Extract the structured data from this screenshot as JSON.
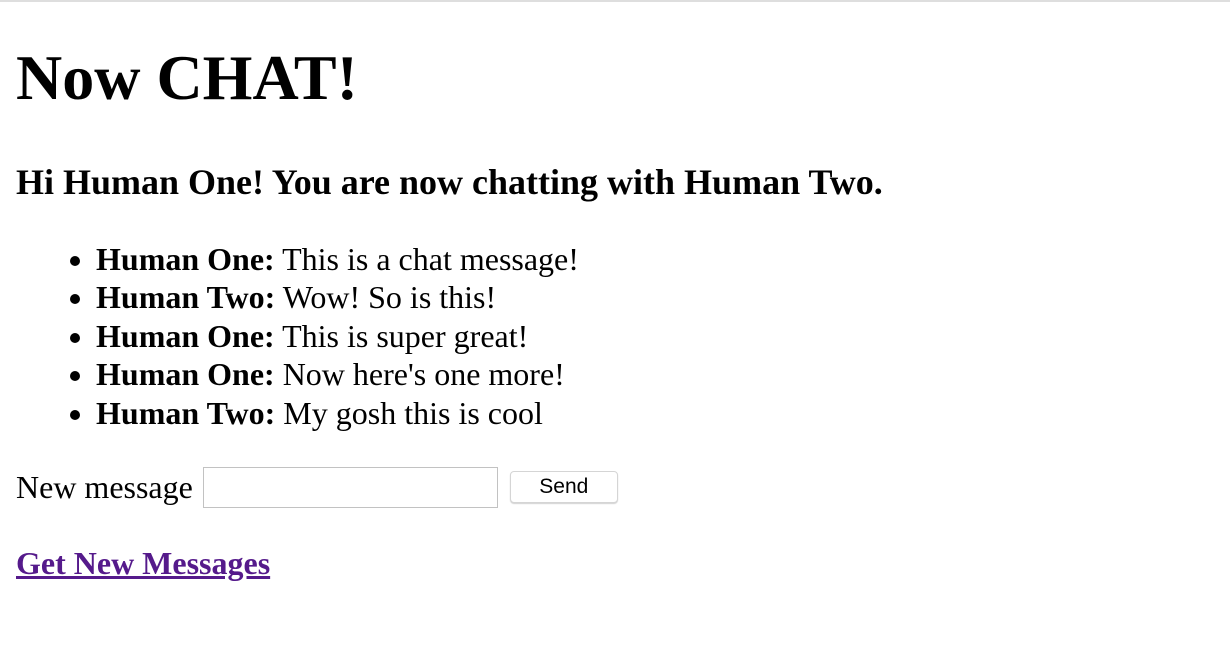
{
  "page": {
    "title": "Now CHAT!",
    "subtitle": "Hi Human One! You are now chatting with Human Two."
  },
  "messages": [
    {
      "sender": "Human One:",
      "text": "This is a chat message!"
    },
    {
      "sender": "Human Two:",
      "text": "Wow! So is this!"
    },
    {
      "sender": "Human One:",
      "text": "This is super great!"
    },
    {
      "sender": "Human One:",
      "text": "Now here's one more!"
    },
    {
      "sender": "Human Two:",
      "text": "My gosh this is cool"
    }
  ],
  "composer": {
    "label": "New message",
    "value": "",
    "send_label": "Send"
  },
  "links": {
    "get_new_messages": "Get New Messages"
  },
  "colors": {
    "visited_link": "#551a8b",
    "input_border": "#c2c2c2"
  }
}
